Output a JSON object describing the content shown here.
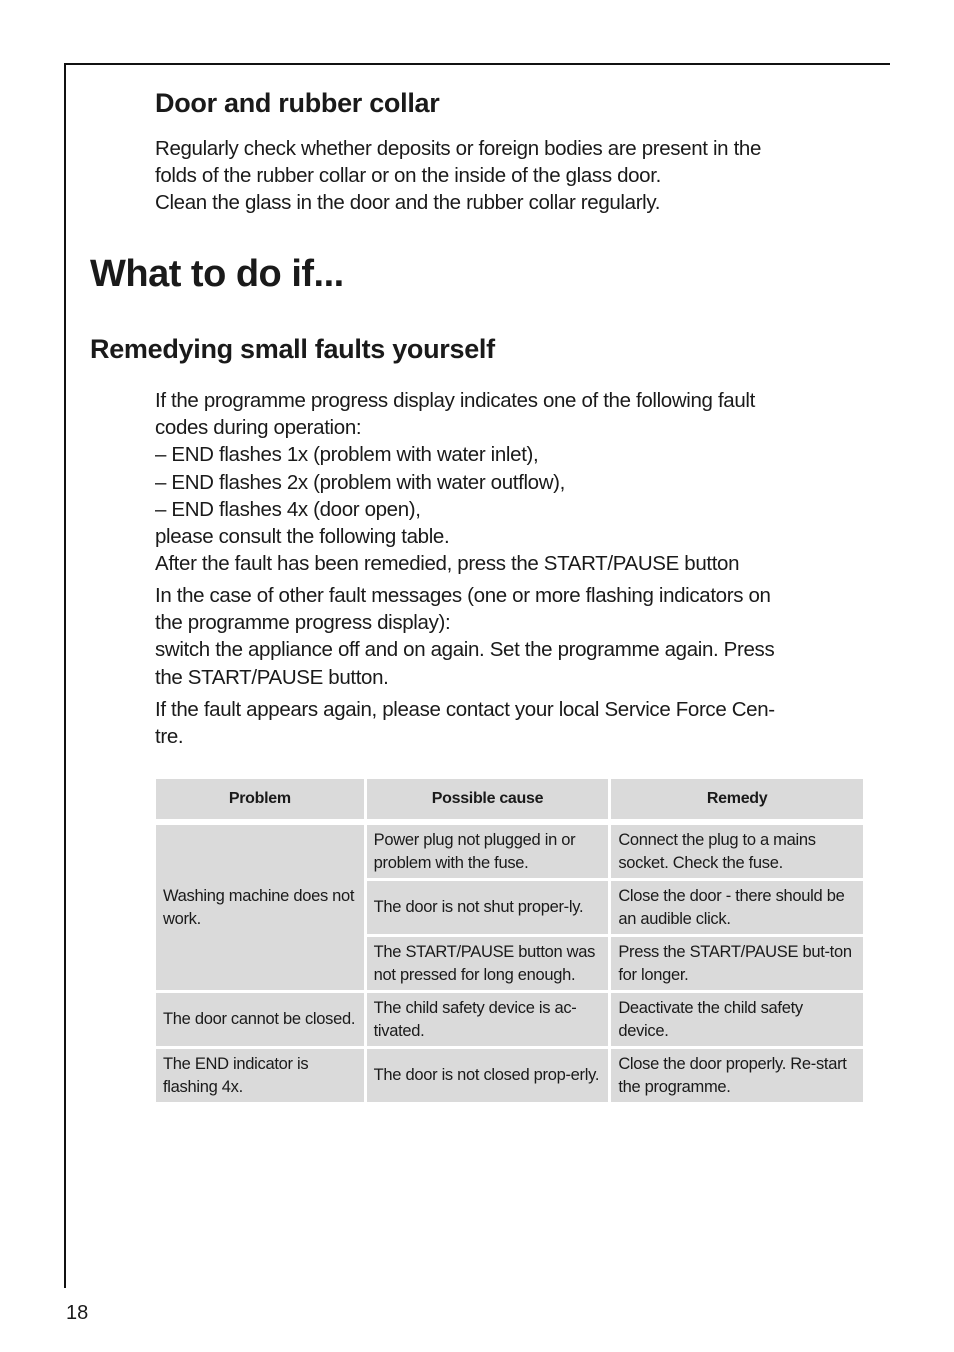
{
  "door_section": {
    "heading": "Door and rubber collar",
    "lines": [
      "Regularly check whether deposits or foreign bodies are present in the",
      "folds of the rubber collar or on the inside of the glass door.",
      "Clean the glass in the door and the rubber collar regularly."
    ]
  },
  "main_heading": "What to do if...",
  "subheading": "Remedying small faults yourself",
  "intro": {
    "lines": [
      "If the programme progress display indicates one of the following fault",
      "codes during operation:",
      "– END flashes 1x (problem with water inlet),",
      "– END flashes 2x (problem with water outflow),",
      "– END flashes 4x (door open),",
      "please consult the following table.",
      "After the fault has been remedied, press the START/PAUSE button"
    ]
  },
  "other_faults": {
    "lines": [
      "In the case of other fault messages (one or more flashing indicators on",
      "the programme progress display):",
      "switch the appliance off and on again. Set the programme again. Press",
      "the START/PAUSE button."
    ]
  },
  "fault_again": {
    "lines": [
      "If the fault appears again, please contact your local Service Force Cen-",
      "tre."
    ]
  },
  "table": {
    "headers": [
      "Problem",
      "Possible cause",
      "Remedy"
    ],
    "groups": [
      {
        "problem": "Washing machine does not work.",
        "rows": [
          {
            "cause": "Power plug not plugged in or problem with the fuse.",
            "remedy": "Connect the plug to a mains socket. Check the fuse."
          },
          {
            "cause": "The door is not shut proper-ly.",
            "remedy": "Close the door - there should be an audible click."
          },
          {
            "cause": "The START/PAUSE button was not pressed for long enough.",
            "remedy": "Press the START/PAUSE but-ton for longer."
          }
        ]
      },
      {
        "problem": "The door cannot be closed.",
        "rows": [
          {
            "cause": "The child safety device is ac-tivated.",
            "remedy": "Deactivate the child safety device."
          }
        ]
      },
      {
        "problem": "The END indicator is flashing 4x.",
        "rows": [
          {
            "cause": "The door is not closed prop-erly.",
            "remedy": "Close the door properly. Re-start the programme."
          }
        ]
      }
    ]
  },
  "page_number": "18"
}
